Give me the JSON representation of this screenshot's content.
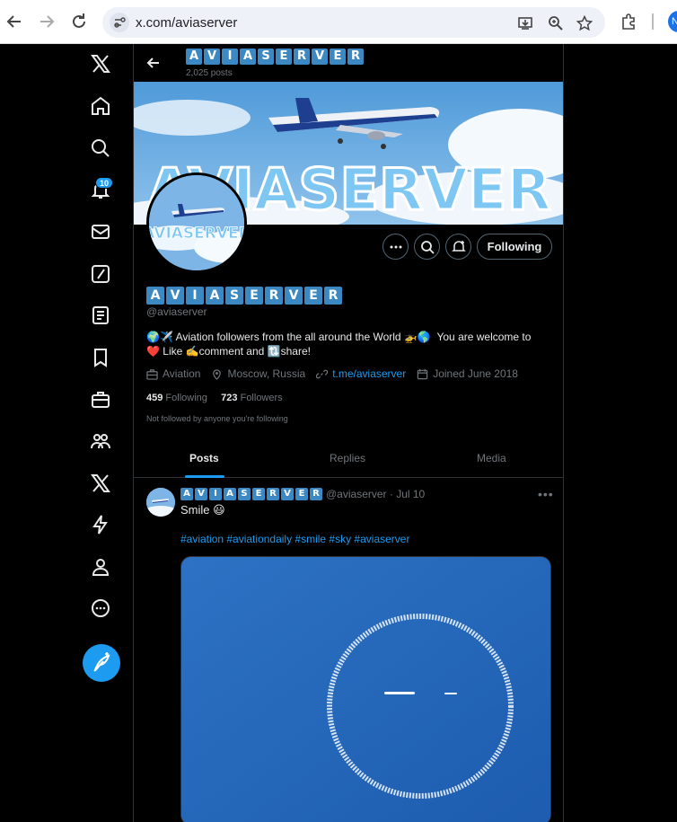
{
  "browser": {
    "url": "x.com/aviaserver",
    "profile_initial": "N"
  },
  "sidebar": {
    "notifications_badge": "10"
  },
  "header": {
    "name_letters": [
      "A",
      "V",
      "I",
      "A",
      "S",
      "E",
      "R",
      "V",
      "E",
      "R"
    ],
    "post_count": "2,025 posts"
  },
  "banner": {
    "text": "AVIASERVER"
  },
  "actions": {
    "following_label": "Following"
  },
  "profile": {
    "name_letters": [
      "A",
      "V",
      "I",
      "A",
      "S",
      "E",
      "R",
      "V",
      "E",
      "R"
    ],
    "handle": "@aviaserver",
    "bio_line1_emoji": "🌍✈️",
    "bio_line1_text": "Aviation followers from the all around the World",
    "bio_line1_emoji2": "🚁🌎",
    "bio_line1_tail": "You are welcome to",
    "bio_line2_emoji": "❤️",
    "bio_line2_like": "Like",
    "bio_line2_emoji2": "✍️",
    "bio_line2_comment": "comment and",
    "bio_line2_emoji3": "🔃",
    "bio_line2_share": "share!",
    "category": "Aviation",
    "location": "Moscow, Russia",
    "link": "t.me/aviaserver",
    "joined": "Joined June 2018",
    "following_count": "459",
    "following_label": "Following",
    "followers_count": "723",
    "followers_label": "Followers",
    "not_followed": "Not followed by anyone you're following"
  },
  "tabs": [
    {
      "label": "Posts",
      "active": true
    },
    {
      "label": "Replies",
      "active": false
    },
    {
      "label": "Media",
      "active": false
    }
  ],
  "tweet": {
    "name_letters": [
      "A",
      "V",
      "I",
      "A",
      "S",
      "E",
      "R",
      "V",
      "E",
      "R"
    ],
    "handle_date": "@aviaserver · Jul 10",
    "text": "Smile 😃",
    "hashtags": "#aviation #aviationdaily #smile #sky #aviaserver"
  },
  "colors": {
    "accent": "#1d9bf0",
    "tile": "#3b88c3",
    "background": "#000000",
    "muted": "#71767b"
  }
}
